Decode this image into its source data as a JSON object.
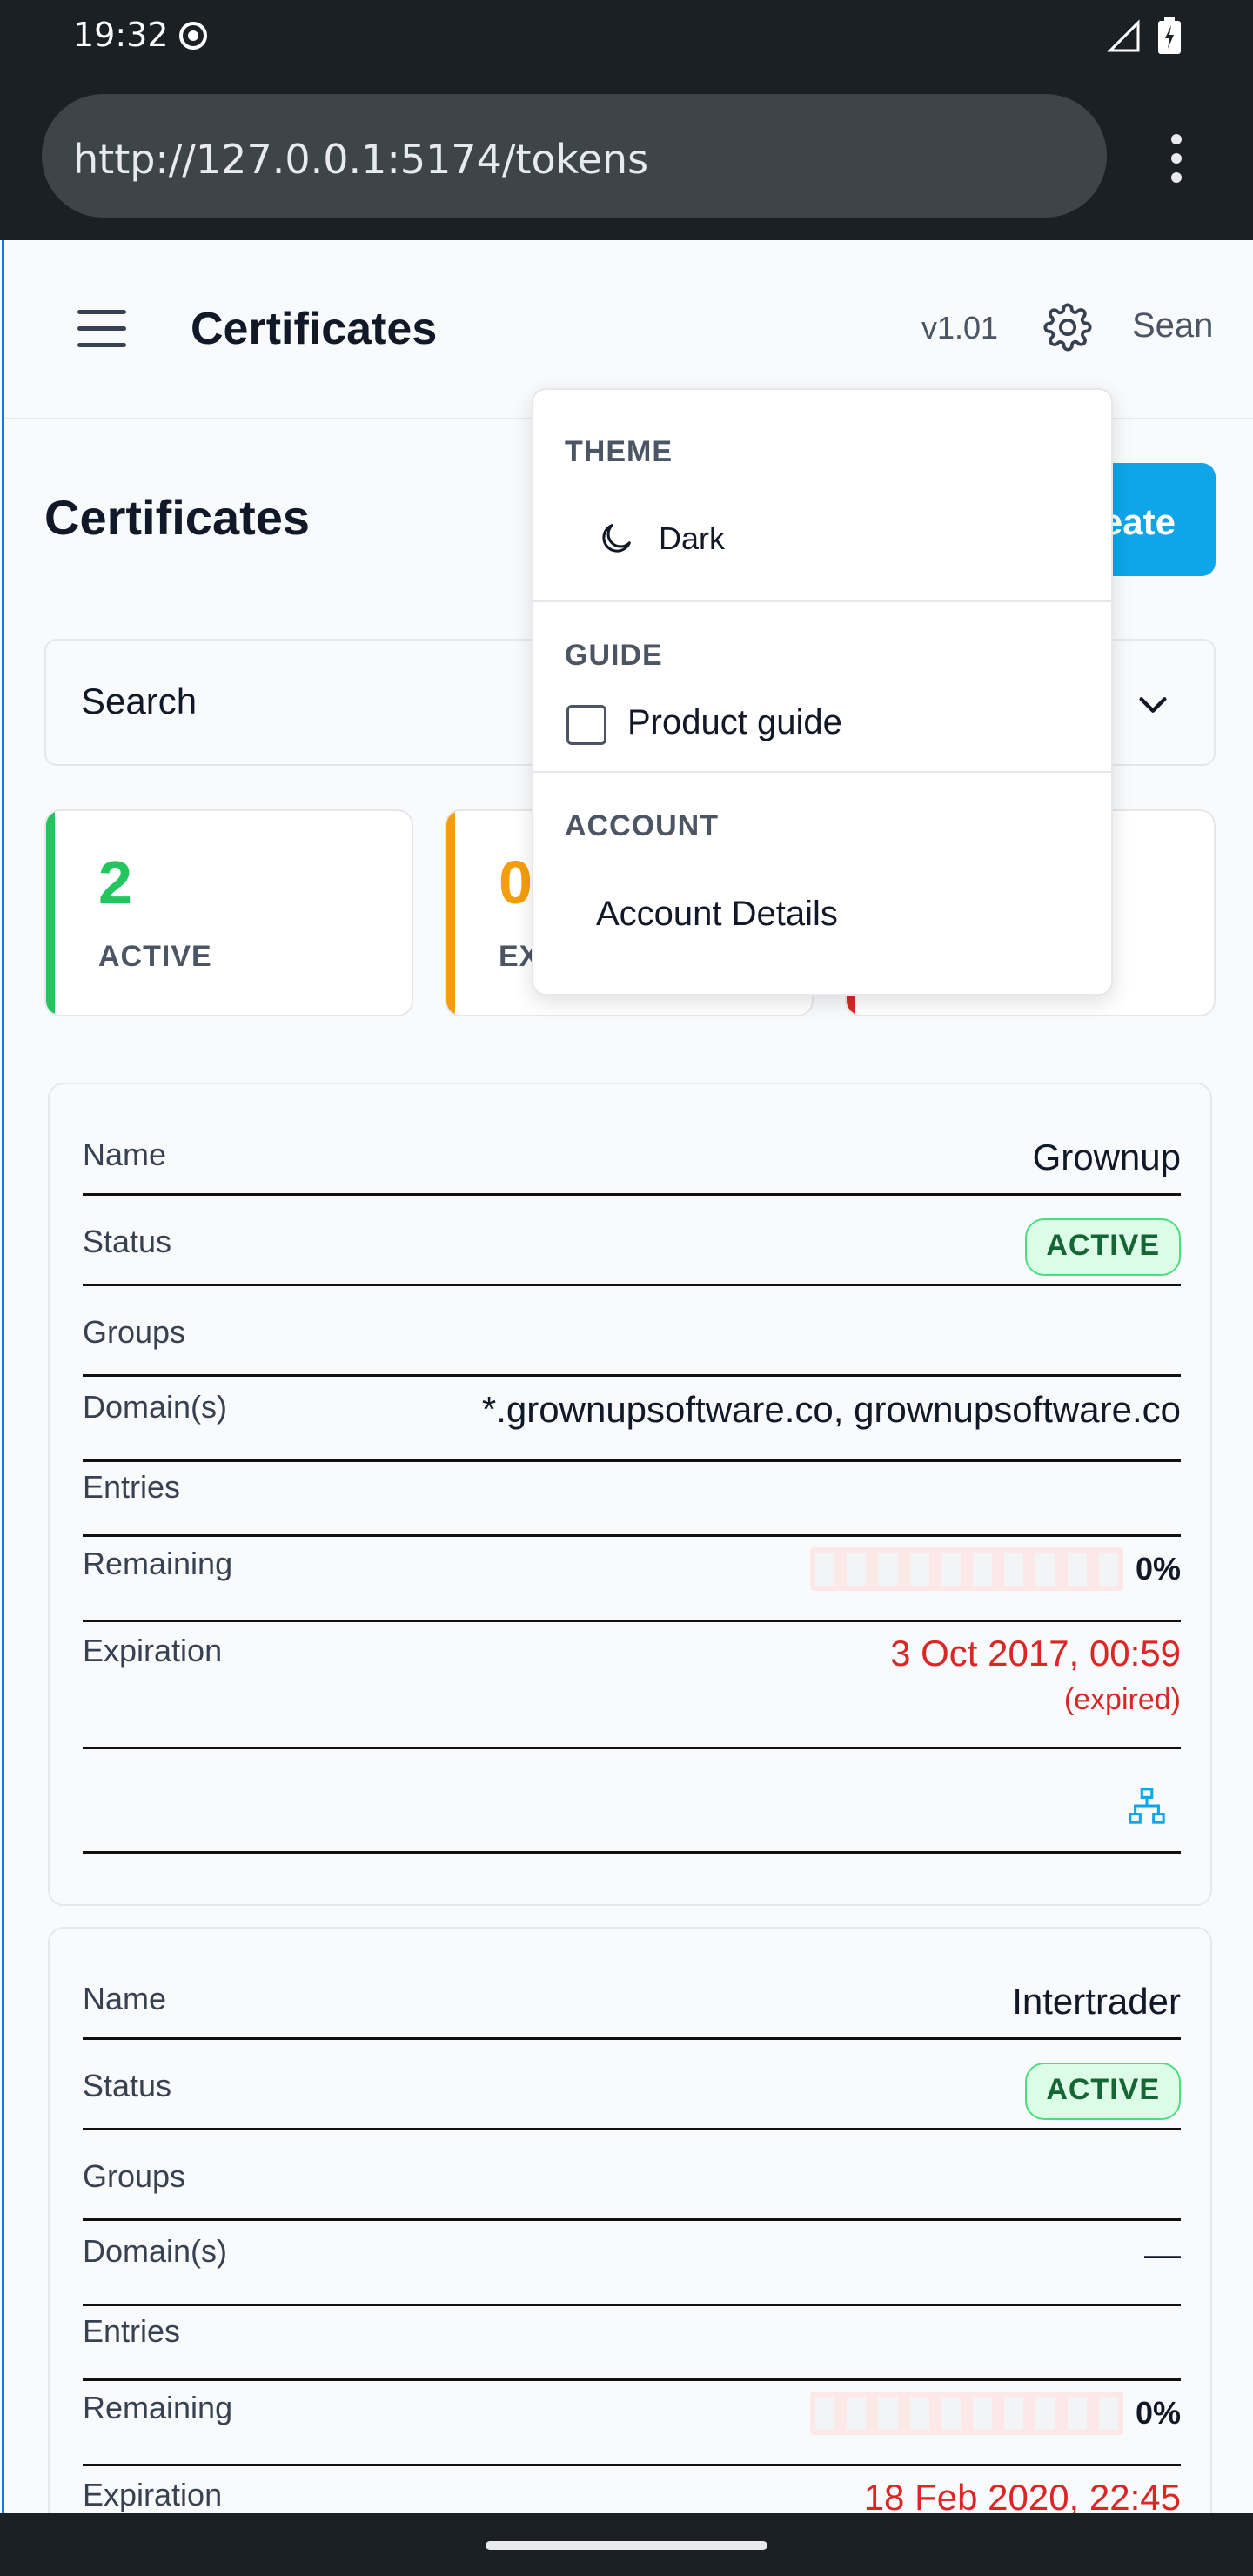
{
  "status_bar": {
    "time": "19:32"
  },
  "browser": {
    "url": "http://127.0.0.1:5174/tokens"
  },
  "header": {
    "title": "Certificates",
    "version": "v1.01",
    "user": "Sean"
  },
  "page": {
    "title": "Certificates",
    "create_label": "Create",
    "search_label": "Search"
  },
  "stats": [
    {
      "value": "2",
      "label": "ACTIVE",
      "color": "#22c55e"
    },
    {
      "value": "0",
      "label": "EXPIRING",
      "color": "#f59e0b"
    },
    {
      "value": "",
      "label": "",
      "color": "#dc2626"
    }
  ],
  "certificates": [
    {
      "name_key": "Name",
      "name": "Grownup",
      "status_key": "Status",
      "status": "ACTIVE",
      "groups_key": "Groups",
      "domains_key": "Domain(s)",
      "domains": "*.grownupsoftware.co, grownupsoftware.co",
      "entries_key": "Entries",
      "remaining_key": "Remaining",
      "remaining": "0%",
      "expiration_key": "Expiration",
      "expiration": "3 Oct 2017, 00:59",
      "expiration_note": "(expired)"
    },
    {
      "name_key": "Name",
      "name": "Intertrader",
      "status_key": "Status",
      "status": "ACTIVE",
      "groups_key": "Groups",
      "domains_key": "Domain(s)",
      "domains": "—",
      "entries_key": "Entries",
      "remaining_key": "Remaining",
      "remaining": "0%",
      "expiration_key": "Expiration",
      "expiration": "18 Feb 2020, 22:45"
    }
  ],
  "menu": {
    "theme_title": "THEME",
    "theme_option": "Dark",
    "guide_title": "GUIDE",
    "guide_option": "Product guide",
    "guide_checked": false,
    "account_title": "ACCOUNT",
    "account_option": "Account Details"
  },
  "icons": {
    "status_dot": "radio-dot-icon",
    "signal": "signal-icon",
    "battery": "battery-icon",
    "menu": "kebab-menu-icon",
    "hamburger": "hamburger-icon",
    "settings": "gear-icon",
    "chevron": "chevron-down-icon",
    "network": "network-tree-icon",
    "theme": "moon-icon"
  },
  "colors": {
    "accent": "#0ea5e9",
    "active": "#22c55e",
    "warning": "#f59e0b",
    "danger": "#dc2626"
  }
}
